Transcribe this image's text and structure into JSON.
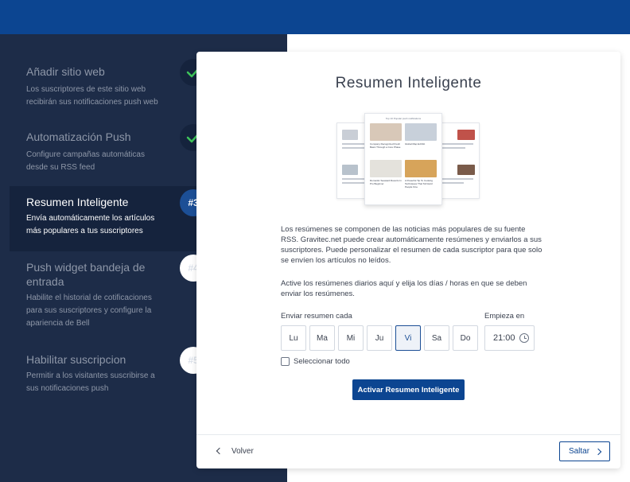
{
  "colors": {
    "brand": "#0c4591",
    "sidebar": "#1d2c48",
    "success": "#3ec45a"
  },
  "steps": [
    {
      "title": "Añadir sitio web",
      "desc": "Los suscriptores de este sitio web recibirán sus notificaciones push web",
      "status": "done",
      "icon": "check-icon"
    },
    {
      "title": "Automatización Push",
      "desc": "Configure campañas automáticas desde su RSS feed",
      "status": "done",
      "icon": "check-icon"
    },
    {
      "title": "Resumen Inteligente",
      "desc": "Envía automáticamente los artículos más populares a tus suscriptores",
      "status": "current",
      "badge": "#3"
    },
    {
      "title": "Push widget bandeja de entrada",
      "desc": "Habilite el historial de cotificaciones para sus suscriptores y configure la apariencia de Bell",
      "status": "todo",
      "badge": "#4"
    },
    {
      "title": "Habilitar suscripcion",
      "desc": "Permitir a los visitantes suscribirse a sus notificaciones push",
      "status": "todo",
      "badge": "#5"
    }
  ],
  "card": {
    "title": "Resumen Inteligente",
    "preview": {
      "header": "Top 10 Popular push notifications",
      "items": [
        "Company Recognized Fresh Basic Through a Core Phase",
        "Global Map Exhibit",
        "Romantic Seaward Resorts In Pro Beginner",
        "A Powerful Tip To Cooking Techniques That Tell Hard People Fine"
      ]
    },
    "paragraph1": "Los resúmenes se componen de las noticias más populares de su fuente RSS. Gravitec.net puede crear automáticamente resúmenes y enviarlos a sus suscriptores. Puede personalizar el resumen de cada suscriptor para que solo se envíen los artículos no leídos.",
    "paragraph2": "Active los resúmenes diarios aquí y elija los días / horas en que se deben enviar los resúmenes.",
    "send_label": "Enviar resumen cada",
    "starts_label": "Empieza en",
    "days": [
      "Lu",
      "Ma",
      "Mi",
      "Ju",
      "Vi",
      "Sa",
      "Do"
    ],
    "selected_day": "Vi",
    "time": "21:00",
    "select_all_label": "Seleccionar todo",
    "select_all_checked": false,
    "activate_label": "Activar Resumen Inteligente",
    "back_label": "Volver",
    "skip_label": "Saltar"
  }
}
